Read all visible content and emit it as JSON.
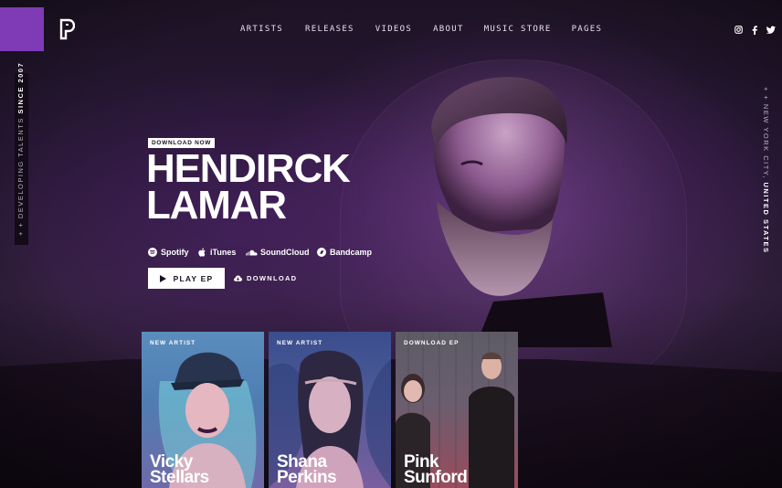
{
  "brand": {
    "accent": "#7e3bb5"
  },
  "nav": {
    "items": [
      "ARTISTS",
      "RELEASES",
      "VIDEOS",
      "ABOUT",
      "MUSIC STORE",
      "PAGES"
    ]
  },
  "social": [
    "instagram-icon",
    "facebook-icon",
    "twitter-icon"
  ],
  "side_left": {
    "prefix": "+ + DEVELOPING TALENTS ",
    "bold": "SINCE 2007"
  },
  "side_right": {
    "prefix": "+ + NEW YORK CITY, ",
    "bold": "UNITED STATES"
  },
  "hero": {
    "badge": "DOWNLOAD NOW",
    "name_line1": "HENDIRCK",
    "name_line2": "LAMAR",
    "stores": [
      "Spotify",
      "iTunes",
      "SoundCloud",
      "Bandcamp"
    ],
    "play_label": "PLAY EP",
    "download_label": "DOWNLOAD"
  },
  "cards": [
    {
      "tag": "NEW ARTIST",
      "title_line1": "Vicky",
      "title_line2": "Stellars"
    },
    {
      "tag": "NEW ARTIST",
      "title_line1": "Shana",
      "title_line2": "Perkins"
    },
    {
      "tag": "DOWNLOAD EP",
      "title_line1": "Pink",
      "title_line2": "Sunford"
    }
  ]
}
